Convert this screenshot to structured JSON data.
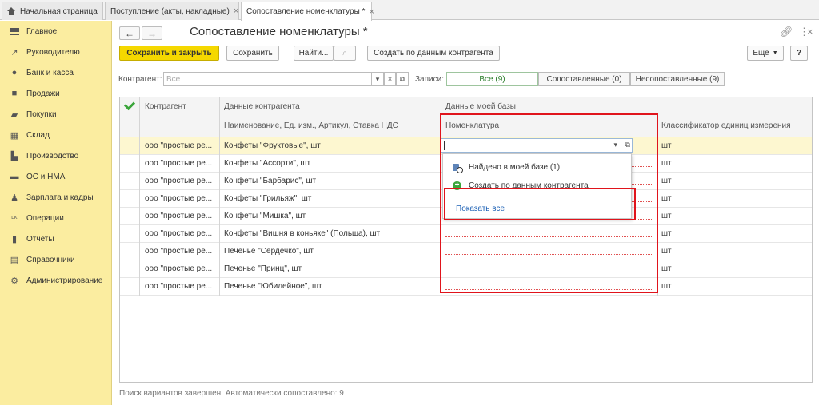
{
  "tabs": [
    {
      "label": "Начальная страница"
    },
    {
      "label": "Поступление (акты, накладные)"
    },
    {
      "label": "Сопоставление номенклатуры *"
    }
  ],
  "sidebar": {
    "items": [
      {
        "label": "Главное",
        "icon": "menu-icon"
      },
      {
        "label": "Руководителю",
        "icon": "trend-icon"
      },
      {
        "label": "Банк и касса",
        "icon": "coin-icon"
      },
      {
        "label": "Продажи",
        "icon": "bag-icon"
      },
      {
        "label": "Покупки",
        "icon": "cart-icon"
      },
      {
        "label": "Склад",
        "icon": "warehouse-icon"
      },
      {
        "label": "Производство",
        "icon": "factory-icon"
      },
      {
        "label": "ОС и НМА",
        "icon": "truck-icon"
      },
      {
        "label": "Зарплата и кадры",
        "icon": "person-icon"
      },
      {
        "label": "Операции",
        "icon": "operations-icon"
      },
      {
        "label": "Отчеты",
        "icon": "chart-icon"
      },
      {
        "label": "Справочники",
        "icon": "book-icon"
      },
      {
        "label": "Администрирование",
        "icon": "gear-icon"
      }
    ]
  },
  "window": {
    "title": "Сопоставление номенклатуры *"
  },
  "toolbar": {
    "save_close": "Сохранить и закрыть",
    "save": "Сохранить",
    "find": "Найти...",
    "create_from_contractor": "Создать по данным контрагента",
    "more": "Еще",
    "help": "?"
  },
  "filter": {
    "contractor_label": "Контрагент:",
    "contractor_placeholder": "Все",
    "records_label": "Записи:",
    "seg_all": "Все (9)",
    "seg_matched": "Сопоставленные (0)",
    "seg_unmatched": "Несопоставленные (9)"
  },
  "grid": {
    "headers": {
      "contractor": "Контрагент",
      "contractor_data": "Данные контрагента",
      "contractor_data_sub": "Наименование, Ед. изм., Артикул, Ставка НДС",
      "my_data": "Данные моей базы",
      "nomenclature": "Номенклатура",
      "unit_classifier": "Классификатор единиц измерения"
    },
    "rows": [
      {
        "contractor": "ооо \"простые ре...",
        "item": "Конфеты \"Фруктовые\", шт",
        "unit": "шт"
      },
      {
        "contractor": "ооо \"простые ре...",
        "item": "Конфеты \"Ассорти\", шт",
        "unit": "шт"
      },
      {
        "contractor": "ооо \"простые ре...",
        "item": "Конфеты \"Барбарис\", шт",
        "unit": "шт"
      },
      {
        "contractor": "ооо \"простые ре...",
        "item": "Конфеты \"Грильяж\", шт",
        "unit": "шт"
      },
      {
        "contractor": "ооо \"простые ре...",
        "item": "Конфеты \"Мишка\", шт",
        "unit": "шт"
      },
      {
        "contractor": "ооо \"простые ре...",
        "item": "Конфеты \"Вишня в коньяке\"  (Польша), шт",
        "unit": "шт"
      },
      {
        "contractor": "ооо \"простые ре...",
        "item": "Печенье \"Сердечко\", шт",
        "unit": "шт"
      },
      {
        "contractor": "ооо \"простые ре...",
        "item": "Печенье \"Принц\", шт",
        "unit": "шт"
      },
      {
        "contractor": "ооо \"простые ре...",
        "item": "Печенье \"Юбилейное\", шт",
        "unit": "шт"
      }
    ]
  },
  "dropdown": {
    "found": "Найдено в моей базе (1)",
    "create": "Создать по данным контрагента",
    "show_all": "Показать все"
  },
  "status": "Поиск вариантов завершен. Автоматически сопоставлено: 9",
  "colors": {
    "sidebar_bg": "#fbeda0",
    "primary_button": "#f5d800",
    "highlight_box": "#e0141c",
    "selected_row": "#fdf7d0",
    "link": "#1a5fb4"
  }
}
